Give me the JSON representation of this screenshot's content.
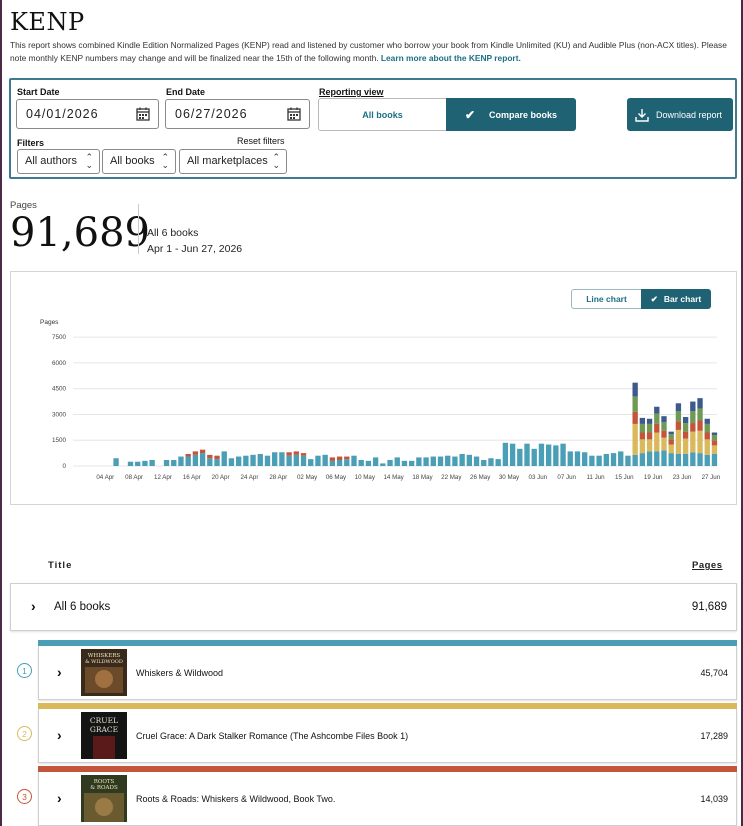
{
  "header": {
    "title": "KENP",
    "description": "This report shows combined Kindle Edition Normalized Pages (KENP) read and listened by customer who borrow your book from Kindle Unlimited (KU) and Audible Plus (non-ACX titles). Please note monthly KENP numbers may change and will be finalized near the 15th of the following month.",
    "learn_more": "Learn more about the KENP report."
  },
  "controls": {
    "start_label": "Start Date",
    "start_value": "04/01/2026",
    "end_label": "End Date",
    "end_value": "06/27/2026",
    "view_label": "Reporting view",
    "view_all": "All books",
    "view_compare": "Compare books",
    "download": "Download report",
    "filters_label": "Filters",
    "reset": "Reset filters",
    "authors": "All authors",
    "books": "All books",
    "marketplaces": "All marketplaces"
  },
  "summary": {
    "label": "Pages",
    "total": "91,689",
    "books": "All 6 books",
    "range": "Apr 1 - Jun 27, 2026"
  },
  "chart_toggle": {
    "line": "Line chart",
    "bar": "Bar chart"
  },
  "colors": {
    "teal": "#4a9eb5",
    "gold": "#d9b95c",
    "rust": "#c4553a",
    "green": "#6f9a56",
    "navy": "#3d5a8c",
    "accent": "#1f6273"
  },
  "chart_data": {
    "type": "bar",
    "stacked": true,
    "ylabel": "Pages",
    "yticks": [
      0,
      1500,
      3000,
      4500,
      6000,
      7500
    ],
    "ylim": [
      0,
      7800
    ],
    "xticks": [
      "04 Apr",
      "08 Apr",
      "12 Apr",
      "16 Apr",
      "20 Apr",
      "24 Apr",
      "28 Apr",
      "02 May",
      "06 May",
      "10 May",
      "14 May",
      "18 May",
      "22 May",
      "26 May",
      "30 May",
      "03 Jun",
      "07 Jun",
      "11 Jun",
      "15 Jun",
      "19 Jun",
      "23 Jun",
      "27 Jun"
    ],
    "series": [
      {
        "color": "#4a9eb5",
        "values": [
          0,
          0,
          450,
          0,
          250,
          250,
          300,
          350,
          0,
          350,
          350,
          550,
          550,
          650,
          750,
          450,
          400,
          850,
          450,
          550,
          600,
          650,
          700,
          600,
          800,
          800,
          600,
          650,
          600,
          400,
          600,
          650,
          300,
          350,
          400,
          600,
          350,
          300,
          500,
          150,
          350,
          500,
          300,
          300,
          500,
          500,
          550,
          550,
          600,
          550,
          700,
          650,
          550,
          350,
          450,
          400,
          1350,
          1300,
          1000,
          1300,
          1000,
          1300,
          1250,
          1200,
          1300,
          850,
          850,
          800,
          600,
          600,
          700,
          750,
          850,
          600,
          650,
          750,
          850,
          850,
          900,
          750,
          700,
          700,
          800,
          750,
          650,
          700
        ]
      },
      {
        "color": "#d9b95c",
        "values": [
          0,
          0,
          0,
          0,
          0,
          0,
          0,
          0,
          0,
          0,
          0,
          0,
          0,
          0,
          0,
          0,
          0,
          0,
          0,
          0,
          0,
          0,
          0,
          0,
          0,
          0,
          0,
          0,
          0,
          0,
          0,
          0,
          0,
          0,
          0,
          0,
          0,
          0,
          0,
          0,
          0,
          0,
          0,
          0,
          0,
          0,
          0,
          0,
          0,
          0,
          0,
          0,
          0,
          0,
          0,
          0,
          0,
          0,
          0,
          0,
          0,
          0,
          0,
          0,
          0,
          0,
          0,
          0,
          0,
          0,
          0,
          0,
          0,
          0,
          1800,
          800,
          700,
          1100,
          750,
          500,
          1400,
          900,
          1200,
          1300,
          900,
          500
        ]
      },
      {
        "color": "#c4553a",
        "values": [
          0,
          0,
          0,
          0,
          0,
          0,
          0,
          0,
          0,
          0,
          0,
          0,
          150,
          200,
          200,
          200,
          200,
          0,
          0,
          0,
          0,
          0,
          0,
          0,
          0,
          0,
          200,
          200,
          150,
          0,
          0,
          0,
          200,
          200,
          150,
          0,
          0,
          0,
          0,
          0,
          0,
          0,
          0,
          0,
          0,
          0,
          0,
          0,
          0,
          0,
          0,
          0,
          0,
          0,
          0,
          0,
          0,
          0,
          0,
          0,
          0,
          0,
          0,
          0,
          0,
          0,
          0,
          0,
          0,
          0,
          0,
          0,
          0,
          0,
          700,
          400,
          400,
          500,
          400,
          300,
          500,
          400,
          500,
          600,
          400,
          300
        ]
      },
      {
        "color": "#6f9a56",
        "values": [
          0,
          0,
          0,
          0,
          0,
          0,
          0,
          0,
          0,
          0,
          0,
          0,
          0,
          0,
          0,
          0,
          0,
          0,
          0,
          0,
          0,
          0,
          0,
          0,
          0,
          0,
          0,
          0,
          0,
          0,
          0,
          0,
          0,
          0,
          0,
          0,
          0,
          0,
          0,
          0,
          0,
          0,
          0,
          0,
          0,
          0,
          0,
          0,
          0,
          0,
          0,
          0,
          0,
          0,
          0,
          0,
          0,
          0,
          0,
          0,
          0,
          0,
          0,
          0,
          0,
          0,
          0,
          0,
          0,
          0,
          0,
          0,
          0,
          0,
          900,
          500,
          500,
          600,
          500,
          300,
          600,
          500,
          700,
          700,
          500,
          300
        ]
      },
      {
        "color": "#3d5a8c",
        "values": [
          0,
          0,
          0,
          0,
          0,
          0,
          0,
          0,
          0,
          0,
          0,
          0,
          0,
          0,
          0,
          0,
          0,
          0,
          0,
          0,
          0,
          0,
          0,
          0,
          0,
          0,
          0,
          0,
          0,
          0,
          0,
          0,
          0,
          0,
          0,
          0,
          0,
          0,
          0,
          0,
          0,
          0,
          0,
          0,
          0,
          0,
          0,
          0,
          0,
          0,
          0,
          0,
          0,
          0,
          0,
          0,
          0,
          0,
          0,
          0,
          0,
          0,
          0,
          0,
          0,
          0,
          0,
          0,
          0,
          0,
          0,
          0,
          0,
          0,
          800,
          350,
          300,
          400,
          350,
          150,
          450,
          350,
          550,
          600,
          300,
          150
        ]
      }
    ]
  },
  "table": {
    "col_title": "Title",
    "col_pages": "Pages",
    "all_label": "All 6 books",
    "all_pages": "91,689",
    "books": [
      {
        "rank": "1",
        "title": "Whiskers & Wildwood",
        "pages": "45,704",
        "color": "#4a9eb5",
        "cover_text": "WHISKERS & WILDWOOD"
      },
      {
        "rank": "2",
        "title": "Cruel Grace: A Dark Stalker Romance (The Ashcombe Files Book 1)",
        "pages": "17,289",
        "color": "#d9b95c",
        "cover_text": "CRUEL GRACE"
      },
      {
        "rank": "3",
        "title": "Roots & Roads: Whiskers & Wildwood, Book Two.",
        "pages": "14,039",
        "color": "#c4553a",
        "cover_text": "ROOTS & ROADS"
      }
    ]
  }
}
